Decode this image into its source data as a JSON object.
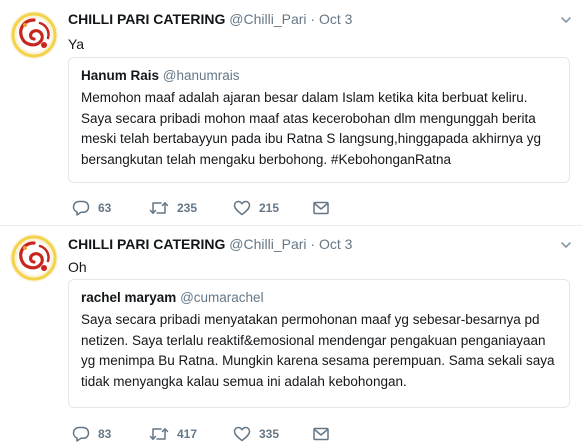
{
  "tweets": [
    {
      "author_name": "CHILLI PARI CATERING",
      "author_handle": "@Chilli_Pari",
      "separator": "·",
      "date": "Oct 3",
      "text": "Ya",
      "quoted": {
        "name": "Hanum Rais",
        "handle": "@hanumrais",
        "lines": [
          "Memohon maaf adalah ajaran besar dalam Islam ketika kita berbuat keliru.",
          "Saya secara pribadi mohon maaf atas kecerobohan dlm mengunggah berita",
          "meski telah bertabayyun pada ibu Ratna S langsung,hinggapada akhirnya yg",
          "bersangkutan telah mengaku berbohong. #KebohonganRatna"
        ]
      },
      "replies": "63",
      "retweets": "235",
      "likes": "215"
    },
    {
      "author_name": "CHILLI PARI CATERING",
      "author_handle": "@Chilli_Pari",
      "separator": "·",
      "date": "Oct 3",
      "text": "Oh",
      "quoted": {
        "name": "rachel maryam",
        "handle": "@cumarachel",
        "lines": [
          "Saya secara pribadi menyatakan permohonan maaf yg sebesar-besarnya pd",
          "netizen. Saya terlalu reaktif&emosional mendengar pengakuan penganiayaan",
          "yg menimpa Bu Ratna. Mungkin karena sesama perempuan. Sama sekali saya",
          "tidak menyangka kalau semua ini adalah kebohongan."
        ]
      },
      "replies": "83",
      "retweets": "417",
      "likes": "335"
    }
  ],
  "icons": {
    "reply": "reply-icon",
    "retweet": "retweet-icon",
    "like": "heart-icon",
    "dm": "envelope-icon",
    "menu": "chevron-down-icon",
    "avatar": "avatar-logo"
  },
  "colors": {
    "text": "#14171a",
    "secondary": "#657786",
    "border": "#e1e8ed",
    "avatar_red": "#c8261d",
    "avatar_yellow": "#f3d34a"
  }
}
